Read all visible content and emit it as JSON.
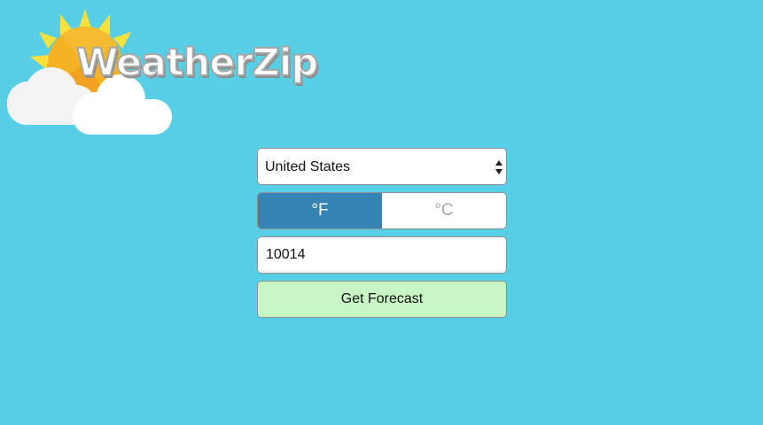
{
  "brand": {
    "logo_text": "WeatherZip",
    "logo_icon": "sun-behind-cloud-icon"
  },
  "form": {
    "country": {
      "selected": "United States",
      "options": [
        "United States"
      ]
    },
    "units": {
      "fahrenheit_label": "°F",
      "celsius_label": "°C",
      "selected": "°F"
    },
    "zip": {
      "value": "10014"
    },
    "submit_label": "Get Forecast"
  },
  "colors": {
    "background": "#57cfe6",
    "active_unit": "#3683b5",
    "submit_button": "#c8f7c5",
    "sun": "#f5b324",
    "sun_rays": "#fce03b"
  }
}
